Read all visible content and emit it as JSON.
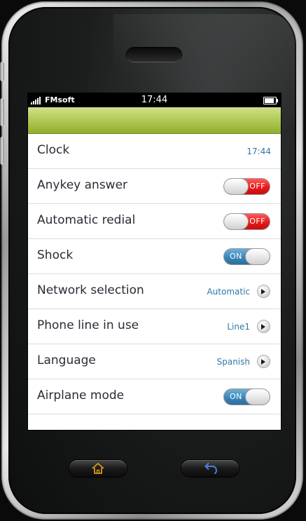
{
  "statusbar": {
    "carrier": "FMsoft",
    "time": "17:44"
  },
  "settings": {
    "items": [
      {
        "label": "Clock",
        "value": "17:44",
        "kind": "value"
      },
      {
        "label": "Anykey answer",
        "kind": "toggle",
        "state": "OFF"
      },
      {
        "label": "Automatic redial",
        "kind": "toggle",
        "state": "OFF"
      },
      {
        "label": "Shock",
        "kind": "toggle",
        "state": "ON"
      },
      {
        "label": "Network selection",
        "value": "Automatic",
        "kind": "link"
      },
      {
        "label": "Phone line in use",
        "value": "Line1",
        "kind": "link"
      },
      {
        "label": "Language",
        "value": "Spanish",
        "kind": "link"
      },
      {
        "label": "Airplane mode",
        "kind": "toggle",
        "state": "ON"
      }
    ]
  },
  "hardware": {
    "home_icon": "home-icon",
    "back_icon": "back-arrow-icon"
  },
  "colors": {
    "titlebar": "#9fbc3f",
    "toggle_off": "#e71a1a",
    "toggle_on": "#3a86b7",
    "value_text": "#2e79a6",
    "home_icon": "#d79a1a",
    "back_icon": "#4a7fe0"
  }
}
